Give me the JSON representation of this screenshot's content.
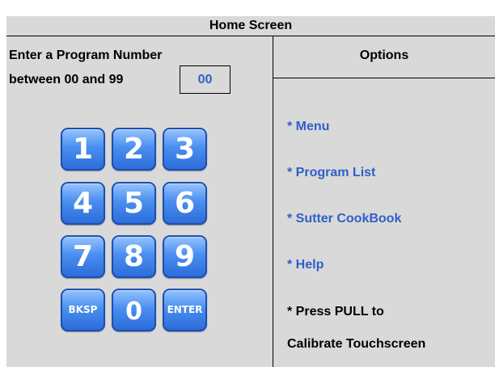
{
  "title": "Home Screen",
  "prompt": {
    "line1": "Enter a Program Number",
    "line2": "between 00 and 99",
    "value": "00"
  },
  "keypad": {
    "k1": "1",
    "k2": "2",
    "k3": "3",
    "k4": "4",
    "k5": "5",
    "k6": "6",
    "k7": "7",
    "k8": "8",
    "k9": "9",
    "bksp": "BKSP",
    "k0": "0",
    "enter": "ENTER"
  },
  "options": {
    "header": "Options",
    "menu": "* Menu",
    "program_list": "* Program List",
    "cookbook": "* Sutter CookBook",
    "help": "* Help",
    "pull_line1": "* Press PULL to",
    "pull_line2": "Calibrate Touchscreen"
  },
  "colors": {
    "background": "#d9d9d9",
    "link": "#2f5fc8",
    "key_blue": "#4a8ff0"
  }
}
